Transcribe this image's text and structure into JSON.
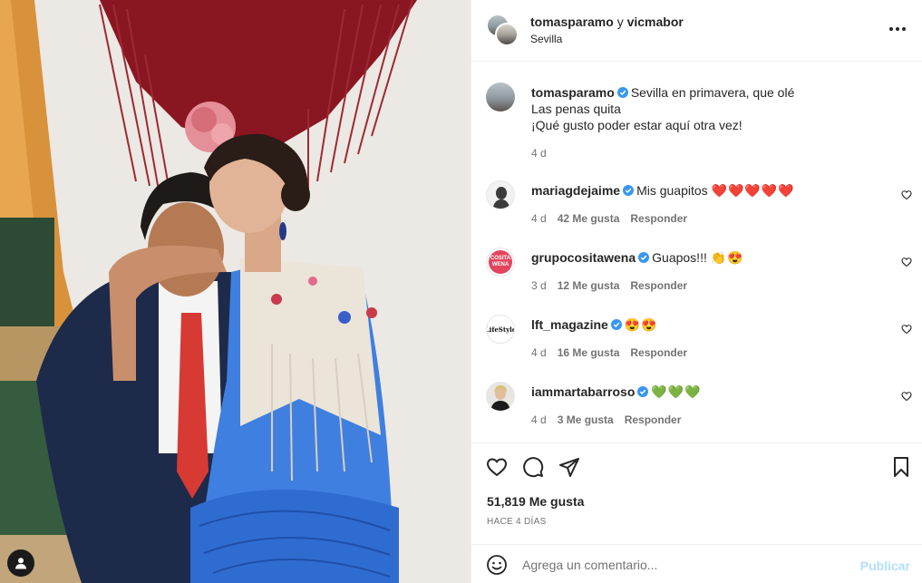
{
  "header": {
    "user1": "tomasparamo",
    "joiner": "y",
    "user2": "vicmabor",
    "location": "Sevilla"
  },
  "caption": {
    "user": "tomasparamo",
    "line1": "Sevilla en primavera, que olé",
    "line2": "Las penas quita",
    "line3": "¡Qué gusto poder estar aquí otra vez!",
    "time": "4 d"
  },
  "comments": [
    {
      "user": "mariagdejaime",
      "text": "Mis guapitos",
      "emoji": "❤️❤️❤️❤️❤️",
      "time": "4 d",
      "likes": "42 Me gusta",
      "reply": "Responder"
    },
    {
      "user": "grupocositawena",
      "text": "Guapos!!!",
      "emoji": "👏😍",
      "time": "3 d",
      "likes": "12 Me gusta",
      "reply": "Responder"
    },
    {
      "user": "lft_magazine",
      "text": "",
      "emoji": "😍😍",
      "time": "4 d",
      "likes": "16 Me gusta",
      "reply": "Responder"
    },
    {
      "user": "iammartabarroso",
      "text": "",
      "emoji": "💚💚💚",
      "time": "4 d",
      "likes": "3 Me gusta",
      "reply": "Responder"
    }
  ],
  "post": {
    "likes": "51,819 Me gusta",
    "ago": "HACE 4 DÍAS"
  },
  "composer": {
    "placeholder": "Agrega un comentario...",
    "post_label": "Publicar"
  },
  "avatar_labels": {
    "cositawena": "COSITA WENA",
    "lifestyle": "LifeStyle"
  },
  "colors": {
    "verified": "#3897f0",
    "link_disabled": "#b2dffc",
    "secondary_text": "#737373"
  }
}
